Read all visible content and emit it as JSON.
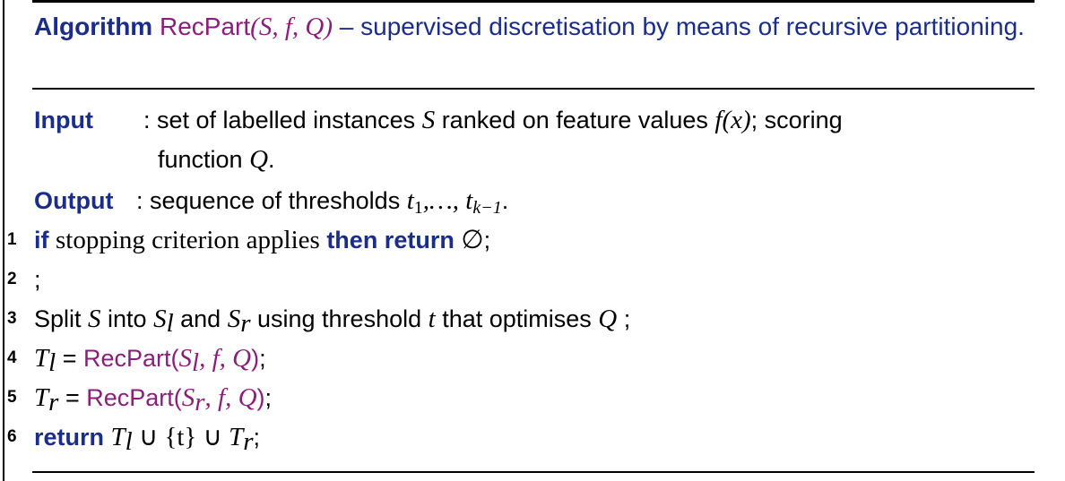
{
  "caption": {
    "keyword": "Algorithm",
    "name": "RecPart",
    "args": "(S, f, Q)",
    "description": "– supervised discretisation by means of recursive partitioning."
  },
  "input": {
    "label": "Input",
    "text_pre": ": set of labelled instances ",
    "S": "S",
    "text_mid": " ranked on feature values ",
    "fx": "f(x)",
    "text_post": "; scoring",
    "line2_pre": "function ",
    "Q": "Q",
    "line2_post": "."
  },
  "output": {
    "label": "Output",
    "text_pre": ": sequence of thresholds ",
    "thresholds": "t",
    "sub1": "1",
    "dots": ",…, t",
    "subk": "k−1",
    "end": "."
  },
  "lines": [
    {
      "num": "1"
    },
    {
      "num": "2",
      "text": ";"
    },
    {
      "num": "3"
    },
    {
      "num": "4"
    },
    {
      "num": "5"
    },
    {
      "num": "6"
    }
  ],
  "line1": {
    "if": "if",
    "cond": "stopping criterion applies",
    "then": "then return",
    "empty": "∅",
    "end": ";"
  },
  "line3": {
    "pre": "Split ",
    "S": "S",
    "into": " into ",
    "Sl": "S",
    "l": "l",
    "and": " and ",
    "Sr": "S",
    "r": "r",
    "using": " using threshold ",
    "t": "t",
    "that": " that optimises ",
    "Q": "Q",
    "end": " ;"
  },
  "line4": {
    "T": "T",
    "l": "l",
    "eq": " = ",
    "fn": "RecPart(",
    "S": "S",
    "sl": "l",
    "args": ", f, Q",
    "close": ")",
    "end": ";"
  },
  "line5": {
    "T": "T",
    "r": "r",
    "eq": " = ",
    "fn": "RecPart(",
    "S": "S",
    "sr": "r",
    "args": ", f, Q",
    "close": ")",
    "end": ";"
  },
  "line6": {
    "ret": "return",
    "T1": "T",
    "l": "l",
    "union1": " ∪ {t} ∪ ",
    "T2": "T",
    "r": "r",
    "end": ";"
  }
}
